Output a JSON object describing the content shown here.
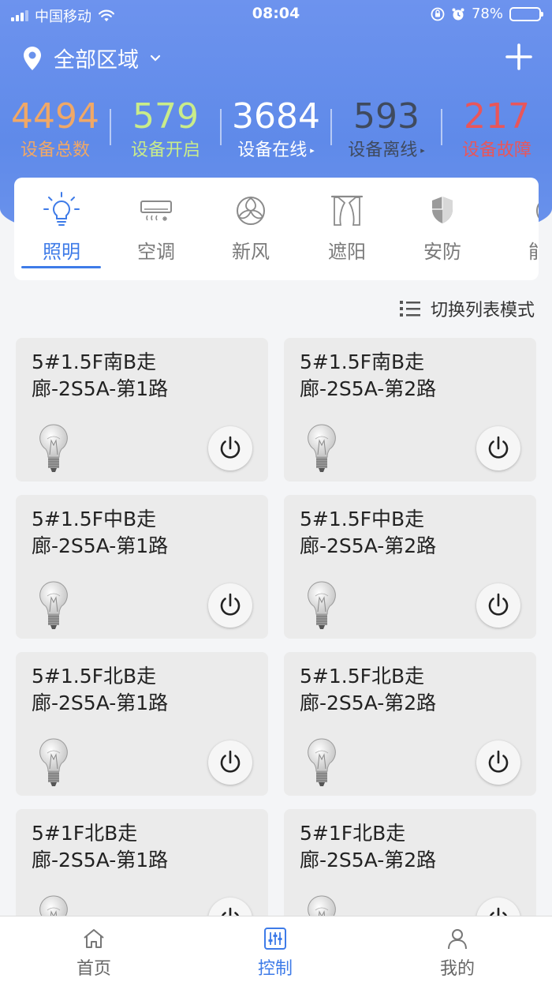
{
  "status_bar": {
    "carrier": "中国移动",
    "time": "08:04",
    "battery_percent": "78%",
    "battery_level": 0.78
  },
  "header": {
    "area_label": "全部区域",
    "area_icon": "location-pin-icon",
    "add_icon": "plus-icon"
  },
  "stats": [
    {
      "value": "4494",
      "label": "设备总数",
      "color": "#f0a867"
    },
    {
      "value": "579",
      "label": "设备开启",
      "color": "#c9ec8a"
    },
    {
      "value": "3684",
      "label": "设备在线",
      "color": "#ffffff",
      "arrow": "▸"
    },
    {
      "value": "593",
      "label": "设备离线",
      "color": "#3f4a5e",
      "arrow": "▸"
    },
    {
      "value": "217",
      "label": "设备故障",
      "color": "#e8565a"
    }
  ],
  "categories": [
    {
      "label": "照明",
      "icon": "lightbulb-icon",
      "active": true
    },
    {
      "label": "空调",
      "icon": "air-conditioner-icon",
      "active": false
    },
    {
      "label": "新风",
      "icon": "fresh-air-icon",
      "active": false
    },
    {
      "label": "遮阳",
      "icon": "curtain-icon",
      "active": false
    },
    {
      "label": "安防",
      "icon": "shield-icon",
      "active": false
    },
    {
      "label": "能",
      "icon": "energy-icon",
      "active": false
    }
  ],
  "list_toggle": {
    "label": "切换列表模式",
    "icon": "list-icon"
  },
  "devices": [
    {
      "name": "5#1.5F南B走廊-2S5A-第1路"
    },
    {
      "name": "5#1.5F南B走廊-2S5A-第2路"
    },
    {
      "name": "5#1.5F中B走廊-2S5A-第1路"
    },
    {
      "name": "5#1.5F中B走廊-2S5A-第2路"
    },
    {
      "name": "5#1.5F北B走廊-2S5A-第1路"
    },
    {
      "name": "5#1.5F北B走廊-2S5A-第2路"
    },
    {
      "name": "5#1F北B走廊-2S5A-第1路"
    },
    {
      "name": "5#1F北B走廊-2S5A-第2路"
    }
  ],
  "tabbar": [
    {
      "label": "首页",
      "icon": "home-icon",
      "active": false
    },
    {
      "label": "控制",
      "icon": "sliders-icon",
      "active": true
    },
    {
      "label": "我的",
      "icon": "user-icon",
      "active": false
    }
  ],
  "colors": {
    "accent": "#3e7be8",
    "header": "#6a92ec"
  }
}
